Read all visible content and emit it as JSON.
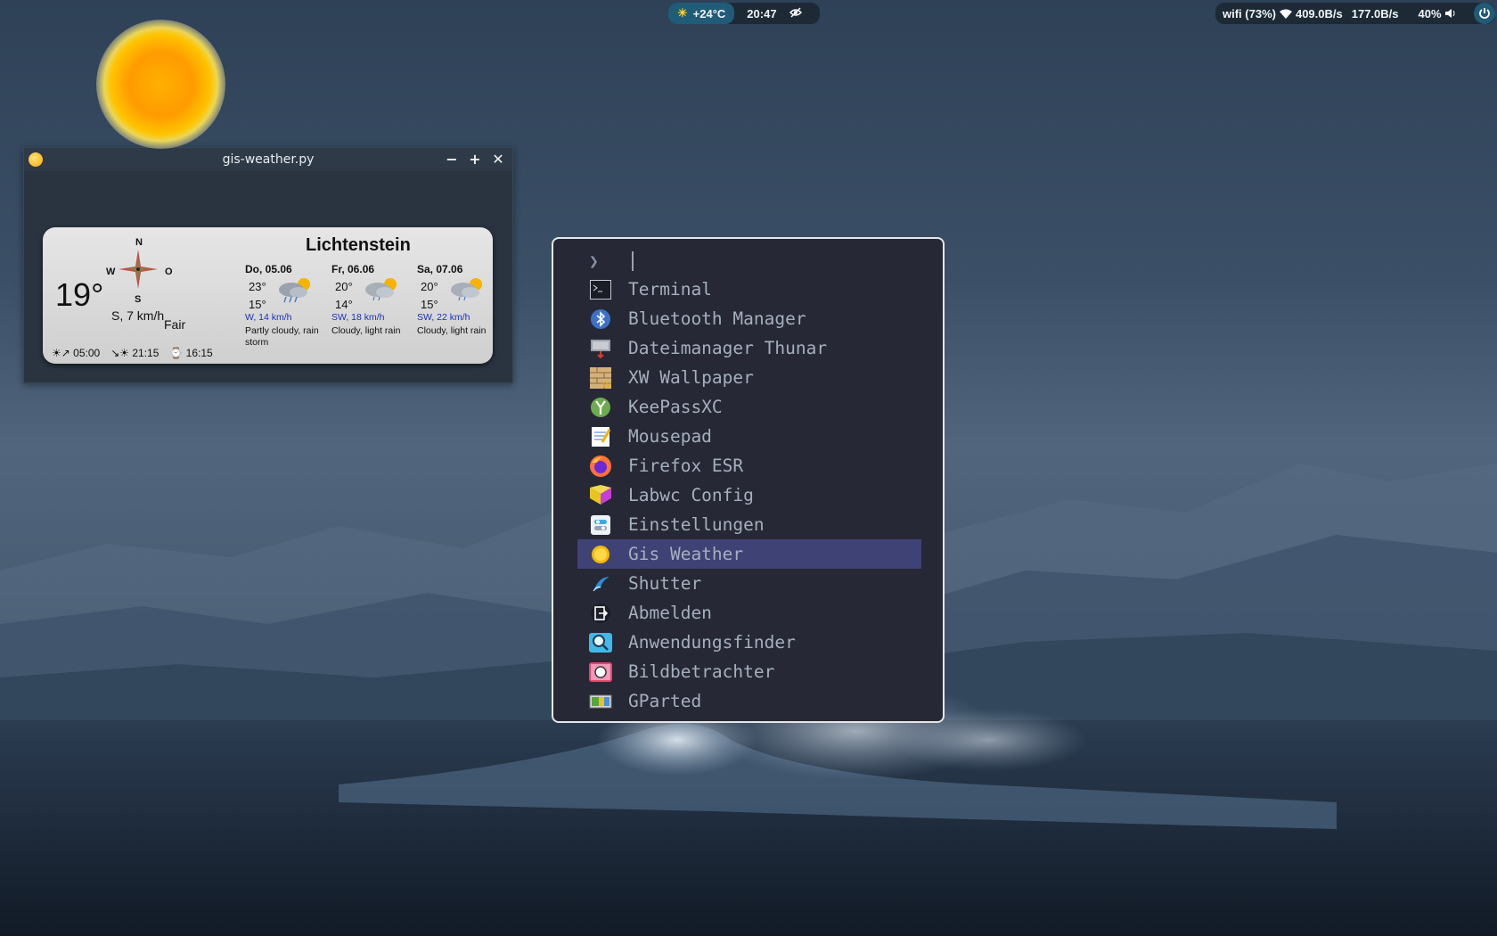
{
  "topbar": {
    "weather": "+24°C",
    "clock": "20:47",
    "wifi": "wifi (73%)",
    "download": "409.0B/s",
    "upload": "177.0B/s",
    "volume": "40%"
  },
  "weather_window": {
    "title": "gis-weather.py",
    "location": "Lichtenstein",
    "current_temp": "19°",
    "wind": "S, 7 km/h",
    "condition": "Fair",
    "compass": {
      "n": "N",
      "w": "W",
      "o": "O",
      "s": "S"
    },
    "forecast": [
      {
        "day": "Do, 05.06",
        "high": "23°",
        "low": "15°",
        "wind": "W, 14 km/h",
        "desc": "Partly cloudy, rain storm"
      },
      {
        "day": "Fr, 06.06",
        "high": "20°",
        "low": "14°",
        "wind": "SW, 18 km/h",
        "desc": "Cloudy, light rain"
      },
      {
        "day": "Sa, 07.06",
        "high": "20°",
        "low": "15°",
        "wind": "SW, 22 km/h",
        "desc": "Cloudy, light rain"
      }
    ],
    "sunrise": "05:00",
    "sunset": "21:15",
    "daylength": "16:15"
  },
  "launcher": {
    "prompt_symbol": "❯",
    "query": "",
    "items": [
      {
        "label": "Terminal",
        "icon": "terminal-icon"
      },
      {
        "label": "Bluetooth Manager",
        "icon": "bluetooth-icon"
      },
      {
        "label": "Dateimanager Thunar",
        "icon": "file-manager-icon"
      },
      {
        "label": "XW Wallpaper",
        "icon": "wallpaper-icon"
      },
      {
        "label": "KeePassXC",
        "icon": "keepassxc-icon"
      },
      {
        "label": "Mousepad",
        "icon": "notepad-icon"
      },
      {
        "label": "Firefox ESR",
        "icon": "firefox-icon"
      },
      {
        "label": "Labwc Config",
        "icon": "labwc-icon"
      },
      {
        "label": "Einstellungen",
        "icon": "settings-icon"
      },
      {
        "label": "Gis Weather",
        "icon": "weather-sun-icon"
      },
      {
        "label": "Shutter",
        "icon": "shutter-icon"
      },
      {
        "label": "Abmelden",
        "icon": "logout-icon"
      },
      {
        "label": "Anwendungsfinder",
        "icon": "app-finder-icon"
      },
      {
        "label": "Bildbetrachter",
        "icon": "image-viewer-icon"
      },
      {
        "label": "GParted",
        "icon": "gparted-icon"
      }
    ],
    "selected_index": 9,
    "colors": {
      "background": "#262836",
      "selected": "#3e4274",
      "text": "#a6afbd"
    }
  }
}
